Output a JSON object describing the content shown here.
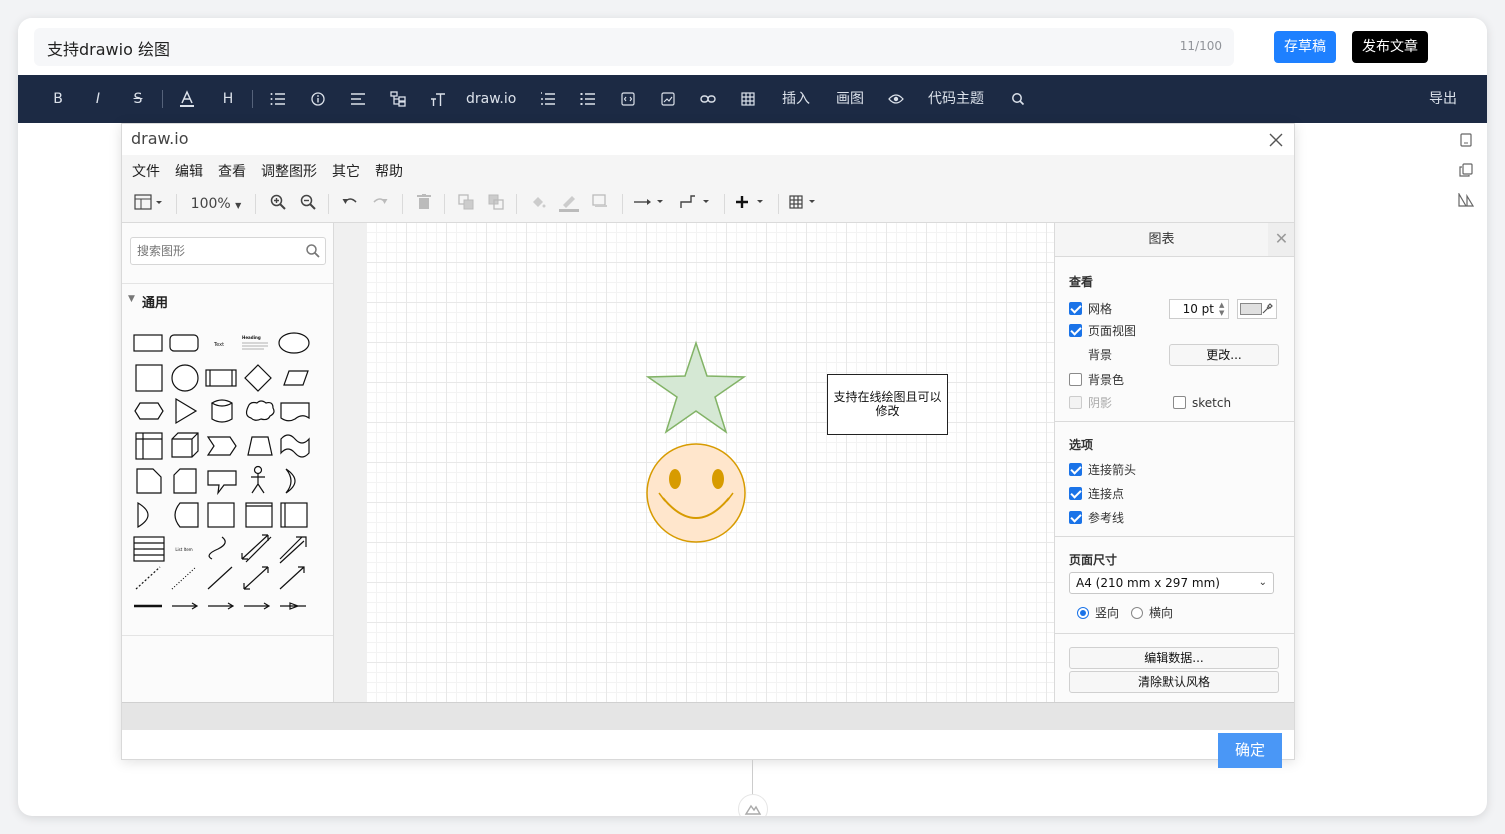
{
  "article": {
    "title": "支持drawio 绘图",
    "title_count": "11/100",
    "save_draft": "存草稿",
    "publish": "发布文章"
  },
  "editor_toolbar": {
    "drawio": "draw.io",
    "insert": "插入",
    "draw": "画图",
    "code_theme": "代码主题",
    "export": "导出"
  },
  "dialog": {
    "title": "draw.io",
    "menus": [
      "文件",
      "编辑",
      "查看",
      "调整图形",
      "其它",
      "帮助"
    ],
    "zoom": "100%",
    "search_placeholder": "搜索图形",
    "section_general": "通用",
    "shape_text_label": "Text",
    "shape_heading_label": "Heading",
    "shape_list_item_label": "List Item",
    "canvas_text": "支持在线绘图且可以修改",
    "confirm": "确定"
  },
  "format_panel": {
    "tab": "图表",
    "view_heading": "查看",
    "grid": "网格",
    "grid_size": "10 pt",
    "page_view": "页面视图",
    "background": "背景",
    "change": "更改...",
    "background_color": "背景色",
    "shadow": "阴影",
    "sketch": "sketch",
    "options_heading": "选项",
    "connection_arrows": "连接箭头",
    "connection_points": "连接点",
    "guides": "参考线",
    "page_size_heading": "页面尺寸",
    "page_size": "A4 (210 mm x 297 mm)",
    "portrait": "竖向",
    "landscape": "横向",
    "edit_data": "编辑数据...",
    "clear_default_style": "清除默认风格"
  },
  "colors": {
    "brand_blue": "#1e80ff",
    "toolbar_bg": "#1c2a44",
    "star_fill": "#d5e8d4",
    "star_stroke": "#82b366",
    "smiley_fill": "#ffe6cc",
    "smiley_stroke": "#d79b00"
  },
  "icons": {
    "bold": "B",
    "italic": "I",
    "strike": "S",
    "heading": "H"
  }
}
